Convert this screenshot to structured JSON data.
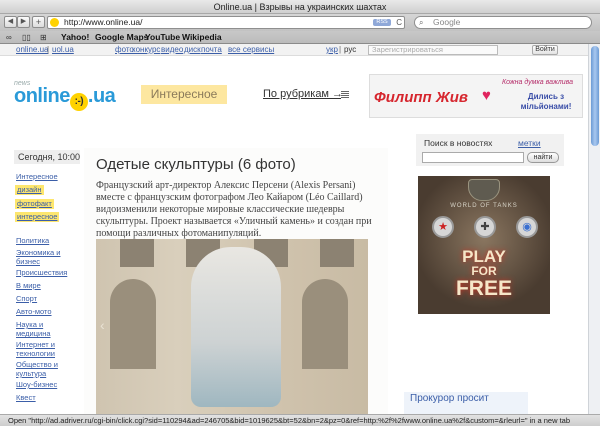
{
  "window": {
    "title": "Online.ua | Взрывы на украинских шахтах"
  },
  "toolbar": {
    "back": "◀",
    "forward": "▶",
    "add": "+",
    "url": "http://www.online.ua/",
    "rss": "RSS",
    "reload": "C",
    "search_placeholder": "Google"
  },
  "bookmarks": [
    "Yahoo!",
    "Google Maps",
    "YouTube",
    "Wikipedia"
  ],
  "topnav": {
    "left": [
      "online.ua",
      "uol.ua"
    ],
    "sep": "|",
    "services": [
      "фото",
      "конкурс",
      "видео",
      "диск",
      "почта",
      "все сервисы"
    ],
    "lang": [
      "укр",
      "рус"
    ],
    "register": "Зарегистрироваться",
    "login": "Войти"
  },
  "header": {
    "logo_small": "news",
    "logo_main": "online",
    "logo_face": ":-)",
    "logo_ua": ".ua",
    "section": "Интересное",
    "rubrics": "По рубрикам →"
  },
  "banner_top": {
    "title": "Филипп Жив",
    "tagline": "Кожна думка важлива",
    "cta": "Дились з мільйонами!"
  },
  "sidebar": {
    "date": "Сегодня, 10:00",
    "section_link": "Интересное",
    "tags": [
      "дизайн",
      "фотофакт",
      "интересное"
    ],
    "rubrics": [
      "Политика",
      "Экономика и бизнес",
      "Происшествия",
      "В мире",
      "Спорт",
      "Авто-мото",
      "Наука и медицина",
      "Интернет и технологии",
      "Общество и культура",
      "Шоу-бизнес",
      "Квест"
    ]
  },
  "article": {
    "headline": "Одетые скульптуры (6 фото)",
    "lead": "Французский арт-директор Алексис Персени (Alexis Persani) вместе с французским фотографом Лео Кайаром (Léo Caillard) видоизменили некоторые мировые классические шедевры скульптуры. Проект называется «Уличный камень» и создан при помощи различных фотоманипуляций.",
    "photo_arrow": "‹"
  },
  "right": {
    "tab_news": "Поиск в новостях",
    "tab_tags": "метки",
    "search_button": "найти",
    "ad_brand": "WORLD OF TANKS",
    "ad_play": "PLAY",
    "ad_for": "FOR",
    "ad_free": "FREE",
    "ad_new": "NEW",
    "news_title": "Прокурор просит"
  },
  "status": "Open \"http://ad.adriver.ru/cgi-bin/click.cgi?sid=110294&ad=246705&bid=1019625&bt=52&bn=2&pz=0&ref=http:%2f%2fwww.online.ua%2f&custom=&rleurl=\" in a new tab"
}
